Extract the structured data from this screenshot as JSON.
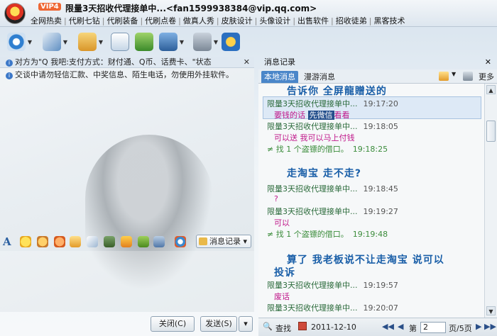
{
  "titlebar": {
    "vip": "VIP4",
    "title": "限量3天招收代理接单中...<fan1599938384@vip.qq.com>",
    "links": [
      "全网热卖",
      "代刷七钻",
      "代刷装备",
      "代刷点卷",
      "做真人秀",
      "皮肤设计",
      "头像设计",
      "出售软件",
      "招收徒弟",
      "黑客技术"
    ]
  },
  "left": {
    "notice1": "对方为\"Q 我吧:支付方式：财付通、Q币、话费卡、\"状态",
    "notice2": "交谈中请勿轻信汇款、中奖信息、陌生电话，勿使用外挂软件。",
    "msgrec_label": "消息记录",
    "close_label": "关闭(C)",
    "send_label": "发送(S)"
  },
  "right": {
    "header": "消息记录",
    "tab_local": "本地消息",
    "tab_roam": "漫游消息",
    "more_label": "更多",
    "messages": [
      {
        "kind": "big",
        "text": "告诉你  全屏龍贈送的"
      },
      {
        "kind": "sender",
        "name": "限量3天招收代理接单中...",
        "time": "19:17:20"
      },
      {
        "kind": "body",
        "text": "要钱的话 先微信看看",
        "hl": "先微信"
      },
      {
        "kind": "sender",
        "name": "限量3天招收代理接单中...",
        "time": "19:18:05"
      },
      {
        "kind": "body",
        "text": "可以送  我可以马上付钱"
      },
      {
        "kind": "warn",
        "text": "找 1 个盗镖的借口。",
        "time": "19:18:25"
      },
      {
        "kind": "big",
        "text": "走淘宝  走不走?"
      },
      {
        "kind": "sender",
        "name": "限量3天招收代理接单中...",
        "time": "19:18:45"
      },
      {
        "kind": "body",
        "text": "?"
      },
      {
        "kind": "sender",
        "name": "限量3天招收代理接单中...",
        "time": "19:19:27"
      },
      {
        "kind": "body",
        "text": "可以"
      },
      {
        "kind": "warn",
        "text": "找 1 个盗镖的借口。",
        "time": "19:19:48"
      },
      {
        "kind": "big",
        "text": "算了  我老板说不让走淘宝  说可以"
      },
      {
        "kind": "big",
        "text": "投诉"
      },
      {
        "kind": "sender",
        "name": "限量3天招收代理接单中...",
        "time": "19:19:57"
      },
      {
        "kind": "body",
        "text": "废话"
      },
      {
        "kind": "sender",
        "name": "限量3天招收代理接单中...",
        "time": "19:20:07"
      }
    ],
    "search_label": "查找",
    "date": "2011-12-10",
    "page_prefix": "第",
    "page_value": "2",
    "page_suffix": "页/5页"
  }
}
